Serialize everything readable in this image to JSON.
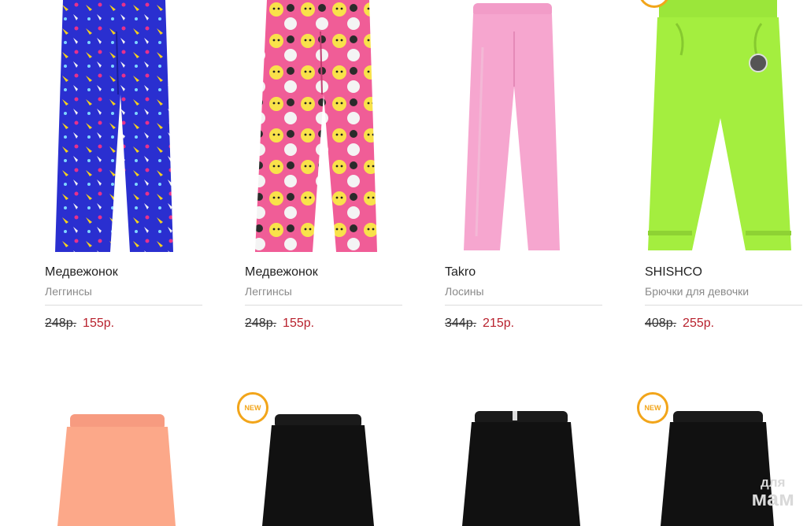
{
  "products_row1": [
    {
      "brand": "Медвежонок",
      "category": "Леггинсы",
      "old_price": "248р.",
      "new_price": "155р.",
      "image_icon": "blue-printed-leggings-image"
    },
    {
      "brand": "Медвежонок",
      "category": "Леггинсы",
      "old_price": "248р.",
      "new_price": "155р.",
      "image_icon": "pink-cat-print-leggings-image"
    },
    {
      "brand": "Takro",
      "category": "Лосины",
      "old_price": "344р.",
      "new_price": "215р.",
      "image_icon": "pink-leggings-image"
    },
    {
      "brand": "SHISHCO",
      "category": "Брючки для девочки",
      "old_price": "408р.",
      "new_price": "255р.",
      "image_icon": "green-pants-image"
    }
  ],
  "products_row2": [
    {
      "image_icon": "peach-shorts-image",
      "badge": ""
    },
    {
      "image_icon": "black-shorts-image",
      "badge": "NEW"
    },
    {
      "image_icon": "black-shorts-image",
      "badge": ""
    },
    {
      "image_icon": "black-shorts-image",
      "badge": "NEW"
    }
  ],
  "watermark": {
    "line1": "для",
    "line2": "мам"
  },
  "colors": {
    "price_new": "#b8212d",
    "badge": "#f2a51a",
    "divider": "#dcdcdc"
  }
}
